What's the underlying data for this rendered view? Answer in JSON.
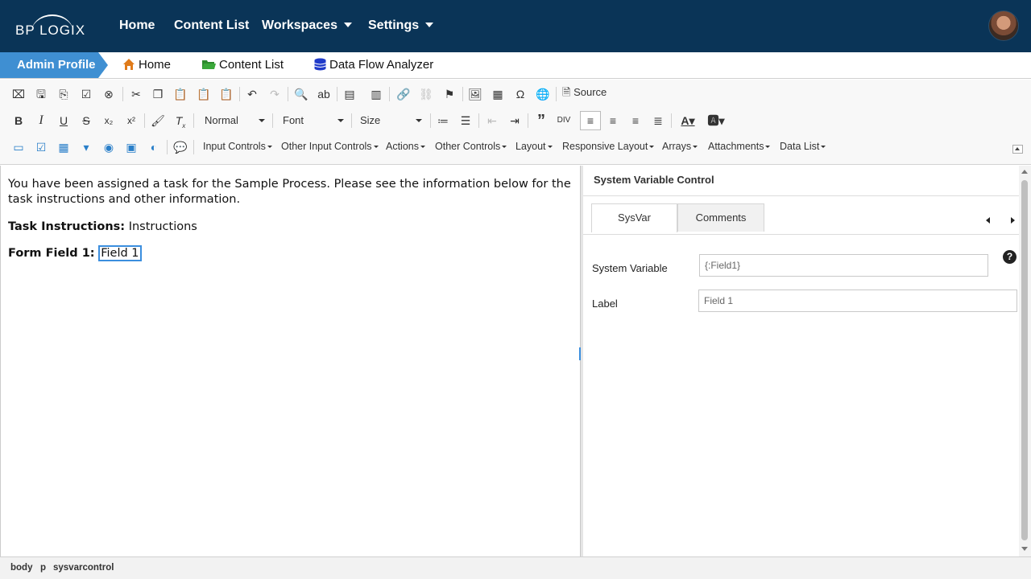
{
  "brand": {
    "logo_text": "BP LOGIX"
  },
  "topnav": {
    "items": [
      {
        "label": "Home"
      },
      {
        "label": "Content List"
      },
      {
        "label": "Workspaces"
      },
      {
        "label": "Settings"
      }
    ]
  },
  "breadcrumb": {
    "active": "Admin Profile",
    "items": [
      {
        "label": "Home",
        "icon": "home-icon"
      },
      {
        "label": "Content List",
        "icon": "folder-icon"
      },
      {
        "label": "Data Flow Analyzer",
        "icon": "database-icon"
      }
    ]
  },
  "toolbar": {
    "source_label": "Source",
    "format_combo": "Normal",
    "font_combo": "Font",
    "size_combo": "Size",
    "menus": [
      "Input Controls",
      "Other Input Controls",
      "Actions",
      "Other Controls",
      "Layout",
      "Responsive Layout",
      "Arrays",
      "Attachments",
      "Data List"
    ]
  },
  "editor": {
    "intro": "You have been assigned a task for the Sample Process. Please see the information below for the task instructions and other information.",
    "task_label": "Task Instructions:",
    "task_value": "Instructions",
    "field_label": "Form Field 1:",
    "field_value": "Field 1"
  },
  "panel": {
    "title": "System Variable Control",
    "tabs": [
      "SysVar",
      "Comments"
    ],
    "system_variable_label": "System Variable",
    "system_variable_value": "{:Field1}",
    "label_label": "Label",
    "label_value": "Field 1",
    "help_glyph": "?"
  },
  "statusbar": {
    "path": [
      "body",
      "p",
      "sysvarcontrol"
    ]
  },
  "colors": {
    "nav_bg": "#0a3457",
    "crumb_active": "#3f8fd2",
    "focus": "#3b8ede"
  }
}
